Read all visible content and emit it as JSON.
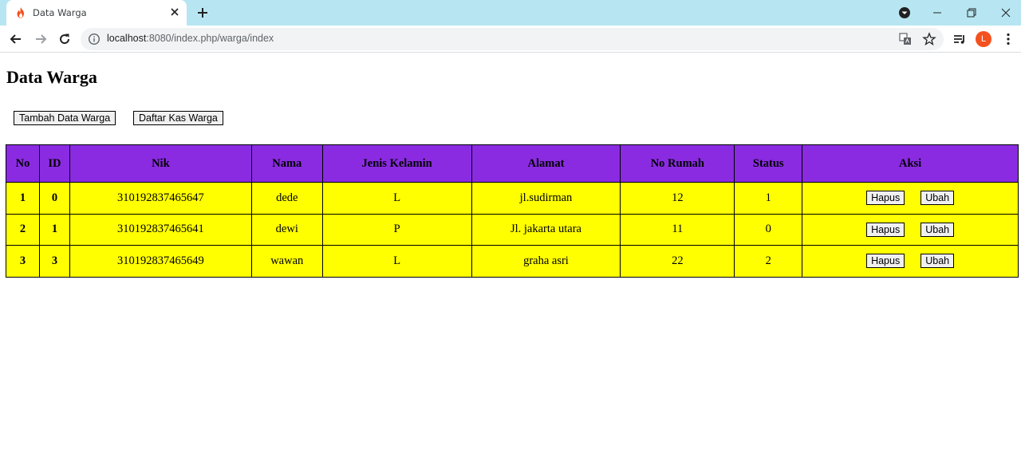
{
  "browser": {
    "tab_title": "Data Warga",
    "url_host": "localhost",
    "url_path": ":8080/index.php/warga/index",
    "profile_initial": "L",
    "tab_bar_color": "#b7e6f2",
    "profile_color": "#f4511e"
  },
  "page": {
    "title": "Data Warga",
    "buttons": {
      "add": "Tambah Data Warga",
      "kas_list": "Daftar Kas Warga"
    }
  },
  "table": {
    "header_color": "#8a2be2",
    "row_color": "#ffff00",
    "columns": [
      "No",
      "ID",
      "Nik",
      "Nama",
      "Jenis Kelamin",
      "Alamat",
      "No Rumah",
      "Status",
      "Aksi"
    ],
    "rows": [
      {
        "no": "1",
        "id": "0",
        "nik": "310192837465647",
        "nama": "dede",
        "jk": "L",
        "alamat": "jl.sudirman",
        "no_rumah": "12",
        "status": "1"
      },
      {
        "no": "2",
        "id": "1",
        "nik": "310192837465641",
        "nama": "dewi",
        "jk": "P",
        "alamat": "Jl. jakarta utara",
        "no_rumah": "11",
        "status": "0"
      },
      {
        "no": "3",
        "id": "3",
        "nik": "310192837465649",
        "nama": "wawan",
        "jk": "L",
        "alamat": "graha asri",
        "no_rumah": "22",
        "status": "2"
      }
    ],
    "actions": {
      "delete": "Hapus",
      "edit": "Ubah"
    }
  },
  "icons": [
    "flame-favicon-icon",
    "close-icon",
    "plus-icon",
    "profile-menu-icon",
    "minimize-icon",
    "restore-icon",
    "window-close-icon",
    "back-arrow-icon",
    "forward-arrow-icon",
    "reload-icon",
    "info-icon",
    "translate-icon",
    "star-icon",
    "reading-list-icon",
    "more-vert-icon"
  ]
}
